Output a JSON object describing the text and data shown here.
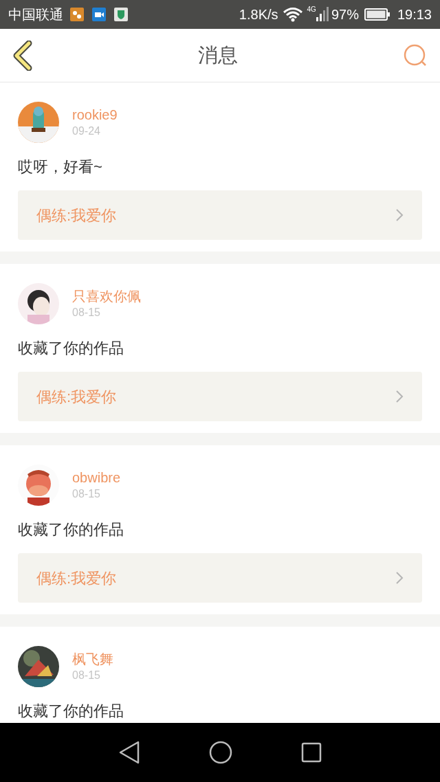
{
  "status_bar": {
    "carrier": "中国联通",
    "speed": "1.8K/s",
    "network": "4G",
    "battery": "97%",
    "time": "19:13"
  },
  "header": {
    "title": "消息"
  },
  "messages": [
    {
      "user": "rookie9",
      "date": "09-24",
      "text": "哎呀，好看~",
      "work": "偶练:我爱你"
    },
    {
      "user": "只喜欢你佩",
      "date": "08-15",
      "text": "收藏了你的作品",
      "work": "偶练:我爱你"
    },
    {
      "user": "obwibre",
      "date": "08-15",
      "text": "收藏了你的作品",
      "work": "偶练:我爱你"
    },
    {
      "user": "枫飞舞",
      "date": "08-15",
      "text": "收藏了你的作品"
    }
  ]
}
